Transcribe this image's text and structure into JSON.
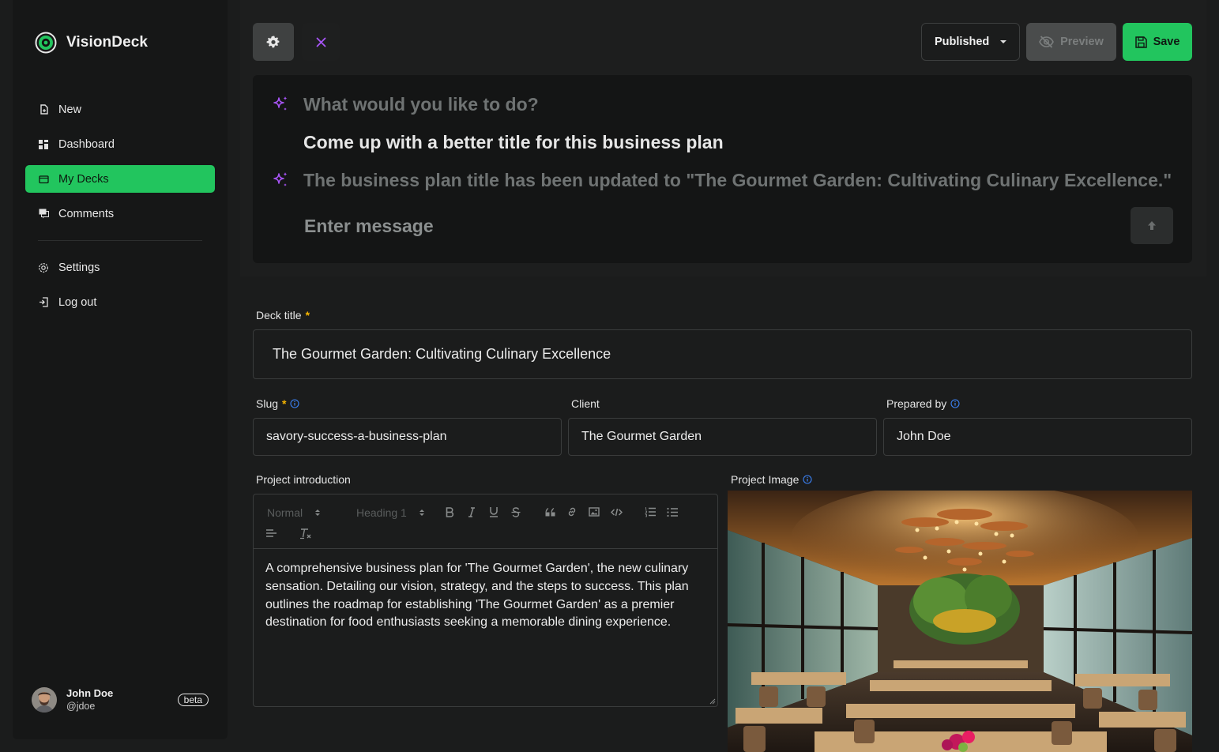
{
  "brand": {
    "name": "VisionDeck",
    "accent": "#22c55e"
  },
  "sidebar": {
    "items": [
      {
        "label": "New",
        "icon": "new-file-icon"
      },
      {
        "label": "Dashboard",
        "icon": "dashboard-icon"
      },
      {
        "label": "My Decks",
        "icon": "folder-icon",
        "active": true
      },
      {
        "label": "Comments",
        "icon": "comments-icon"
      },
      {
        "label": "Settings",
        "icon": "gear-icon"
      },
      {
        "label": "Log out",
        "icon": "logout-icon"
      }
    ]
  },
  "user": {
    "name": "John Doe",
    "handle": "@jdoe",
    "badge": "beta"
  },
  "toolbar": {
    "status": "Published",
    "preview_label": "Preview",
    "save_label": "Save"
  },
  "ai": {
    "prompt": "What would you like to do?",
    "user_message": "Come up with a better title for this business plan",
    "reply": "The business plan title has been updated to \"The Gourmet Garden: Cultivating Culinary Excellence.\"",
    "input_placeholder": "Enter message"
  },
  "form": {
    "deck_title": {
      "label": "Deck title",
      "required": "*",
      "value": "The Gourmet Garden: Cultivating Culinary Excellence"
    },
    "slug": {
      "label": "Slug",
      "required": "*",
      "value": "savory-success-a-business-plan"
    },
    "client": {
      "label": "Client",
      "value": "The Gourmet Garden"
    },
    "prepared_by": {
      "label": "Prepared by",
      "value": "John Doe"
    },
    "intro": {
      "label": "Project introduction",
      "toolbar": {
        "block_style": "Normal",
        "heading": "Heading 1"
      },
      "text": "A comprehensive business plan for 'The Gourmet Garden', the new culinary sensation. Detailing our vision, strategy, and the steps to success. This plan outlines the roadmap for establishing 'The Gourmet Garden' as a premier destination for food enthusiasts seeking a memorable dining experience."
    },
    "project_image": {
      "label": "Project Image"
    }
  }
}
